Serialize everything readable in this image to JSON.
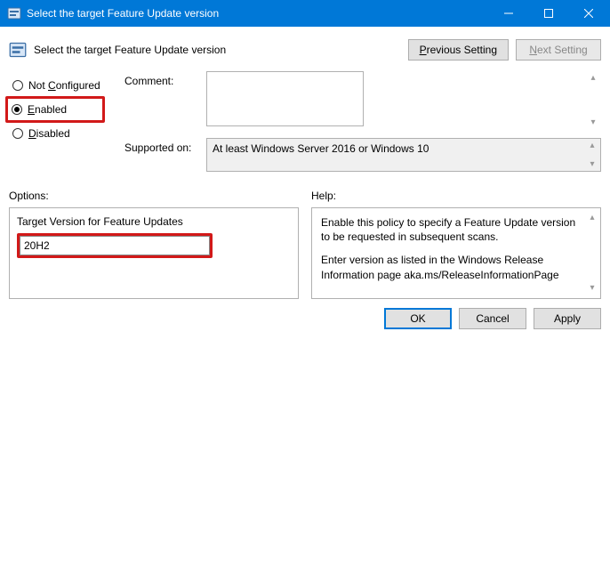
{
  "window": {
    "title": "Select the target Feature Update version"
  },
  "header": {
    "policy_title": "Select the target Feature Update version",
    "prev_setting": {
      "prefix": "P",
      "rest": "revious Setting"
    },
    "next_setting": {
      "prefix": "N",
      "rest": "ext Setting"
    }
  },
  "radios": {
    "not_configured": {
      "prefix": "C",
      "rest_a": "Not ",
      "rest_b": "onfigured"
    },
    "enabled": {
      "prefix": "E",
      "rest": "nabled"
    },
    "disabled": {
      "prefix": "D",
      "rest": "isabled"
    },
    "selected": "enabled"
  },
  "fields": {
    "comment_label": "Comment:",
    "comment_value": "",
    "supported_label": "Supported on:",
    "supported_value": "At least Windows Server 2016 or Windows 10"
  },
  "options": {
    "section_label": "Options:",
    "target_version_label": "Target Version for Feature Updates",
    "target_version_value": "20H2"
  },
  "help": {
    "section_label": "Help:",
    "p1": "Enable this policy to specify a Feature Update version to be requested in subsequent scans.",
    "p2": "Enter version as listed in the Windows Release Information page aka.ms/ReleaseInformationPage"
  },
  "buttons": {
    "ok": "OK",
    "cancel": "Cancel",
    "apply": "Apply"
  }
}
